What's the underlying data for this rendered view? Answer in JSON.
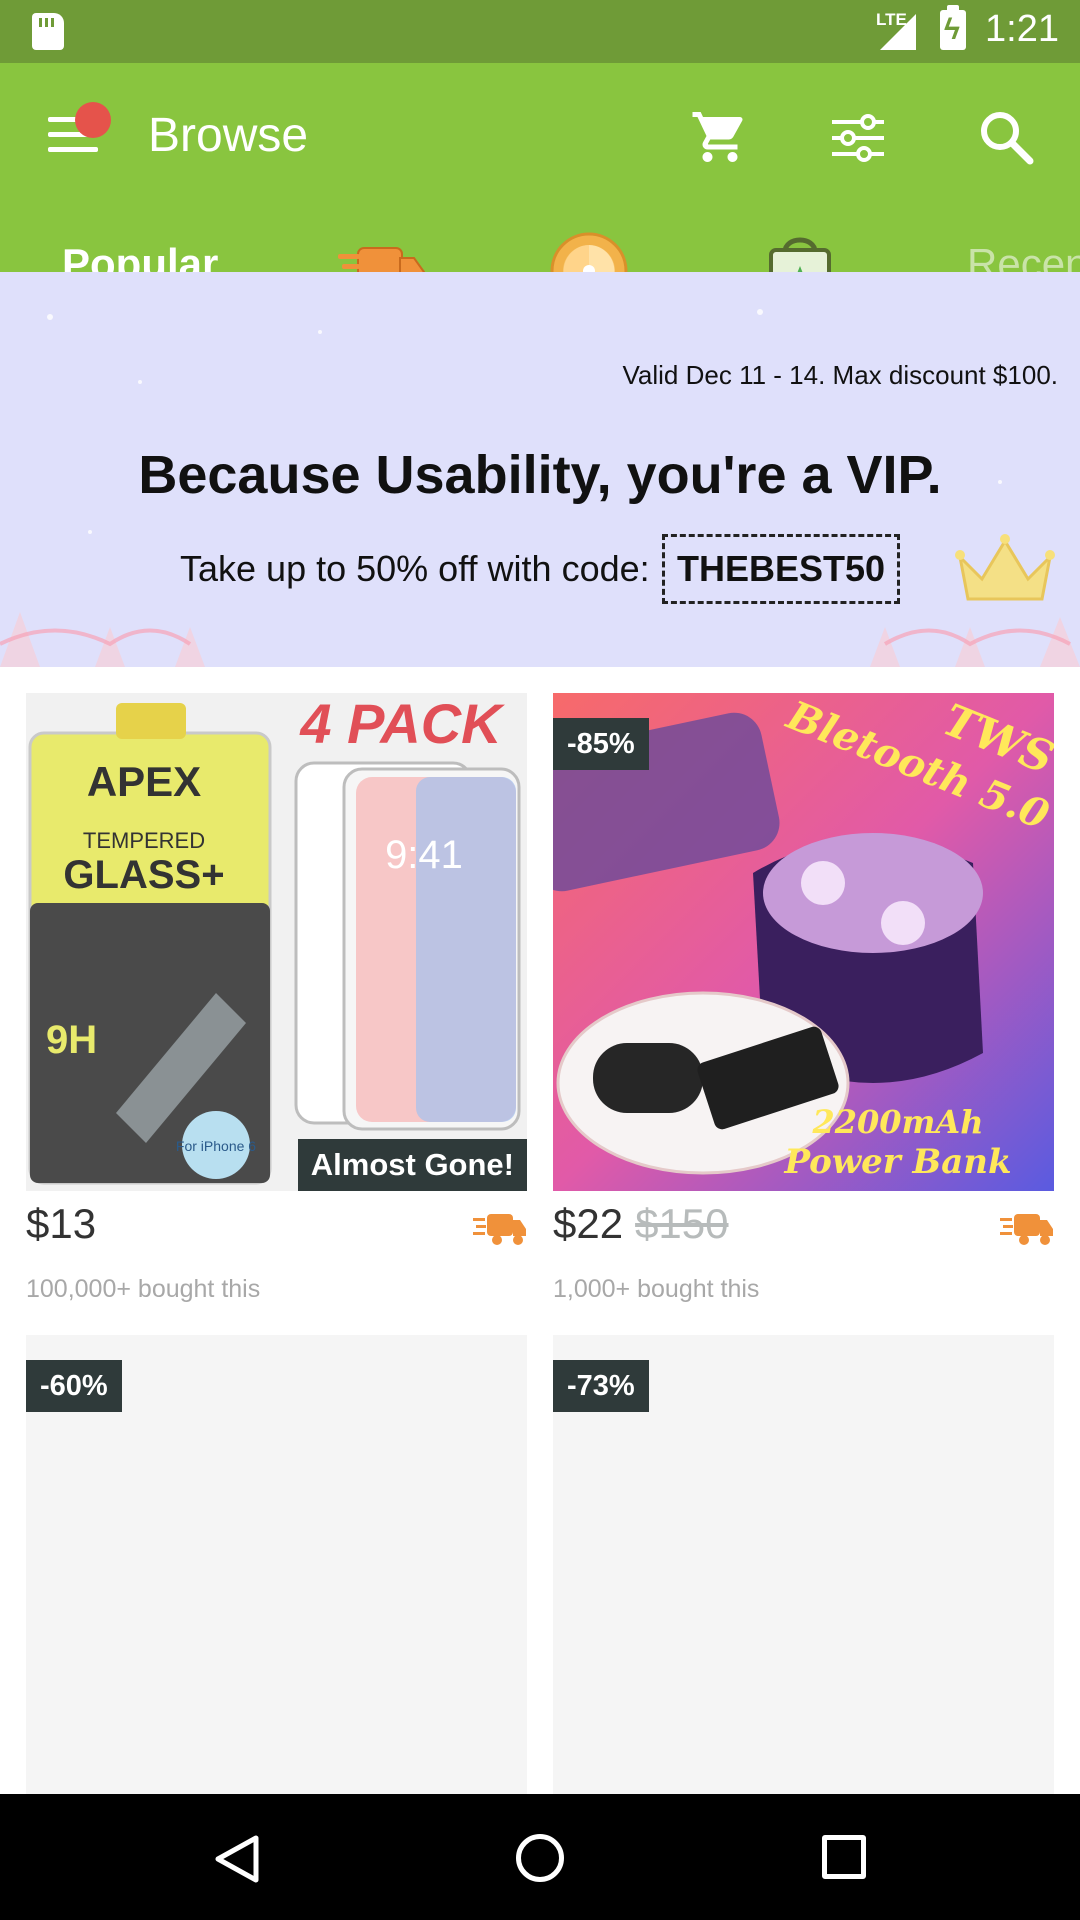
{
  "status_bar": {
    "network": "LTE",
    "time": "1:21"
  },
  "app_bar": {
    "title": "Browse"
  },
  "tabs": [
    {
      "label": "Popular",
      "selected": true
    },
    {
      "icon": "shipping-truck-icon"
    },
    {
      "icon": "daily-deal-icon"
    },
    {
      "icon": "blitz-buy-bag-icon"
    },
    {
      "label": "Recen"
    }
  ],
  "promo": {
    "valid": "Valid Dec 11 - 14. Max discount $100.",
    "headline": "Because Usability, you're a VIP.",
    "offer": "Take up to 50% off with code:",
    "code": "THEBEST50"
  },
  "products": [
    {
      "image_text": {
        "brand": "APEX",
        "pack": "4 PACK",
        "line1": "TEMPERED",
        "line2": "GLASS+",
        "hardness": "9H",
        "model": "For iPhone 6",
        "screen_time": "9:41"
      },
      "badge": "Almost Gone!",
      "price": "$13",
      "old_price": "",
      "bought": "100,000+ bought this"
    },
    {
      "image_text": {
        "line1": "TWS",
        "line2": "Bletooth 5.0",
        "line3": "2200mAh",
        "line4": "Power Bank"
      },
      "discount": "-85%",
      "price": "$22",
      "old_price": "$150",
      "bought": "1,000+ bought this"
    },
    {
      "discount": "-60%"
    },
    {
      "discount": "-73%"
    }
  ],
  "colors": {
    "status_bar": "#6f9b37",
    "app_bar": "#89c53f",
    "promo_bg": "#dfe0fb",
    "badge": "#2f3a3a",
    "shipping_orange": "#f0913a",
    "notification_dot": "#e5534b"
  }
}
